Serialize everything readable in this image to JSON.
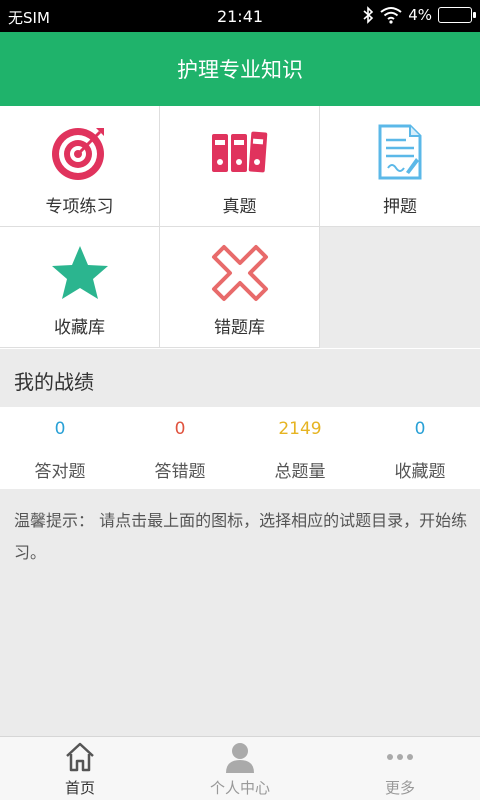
{
  "status_bar": {
    "carrier": "无SIM",
    "time": "21:41",
    "battery": "4%"
  },
  "header": {
    "title": "护理专业知识"
  },
  "menu": [
    {
      "label": "专项练习",
      "icon": "target-icon"
    },
    {
      "label": "真题",
      "icon": "binders-icon"
    },
    {
      "label": "押题",
      "icon": "document-pen-icon"
    },
    {
      "label": "收藏库",
      "icon": "star-icon"
    },
    {
      "label": "错题库",
      "icon": "cross-icon"
    }
  ],
  "record": {
    "title": "我的战绩",
    "stats": [
      {
        "value": "0",
        "label": "答对题",
        "color": "#2aa1d6"
      },
      {
        "value": "0",
        "label": "答错题",
        "color": "#e0533f"
      },
      {
        "value": "2149",
        "label": "总题量",
        "color": "#e6b422"
      },
      {
        "value": "0",
        "label": "收藏题",
        "color": "#2aa1d6"
      }
    ]
  },
  "tip": "温馨提示： 请点击最上面的图标，选择相应的试题目录，开始练习。",
  "tabbar": [
    {
      "label": "首页",
      "icon": "home-icon",
      "active": true
    },
    {
      "label": "个人中心",
      "icon": "person-icon",
      "active": false
    },
    {
      "label": "更多",
      "icon": "more-icon",
      "active": false
    }
  ],
  "colors": {
    "brand_green": "#1fb36b",
    "icon_red": "#e0335d",
    "icon_teal": "#2bb58f",
    "icon_blue": "#5bb8e8"
  }
}
